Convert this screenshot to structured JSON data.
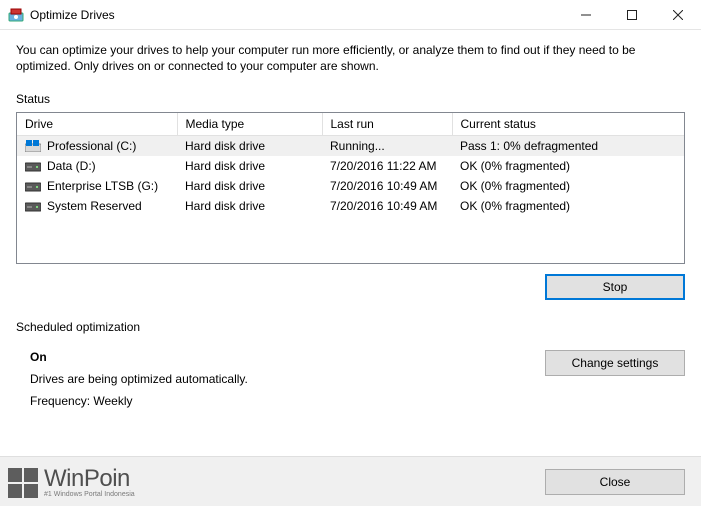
{
  "titlebar": {
    "title": "Optimize Drives"
  },
  "description": "You can optimize your drives to help your computer run more efficiently, or analyze them to find out if they need to be optimized. Only drives on or connected to your computer are shown.",
  "status_label": "Status",
  "columns": {
    "drive": "Drive",
    "media": "Media type",
    "last": "Last run",
    "status": "Current status"
  },
  "drives": [
    {
      "name": "Professional (C:)",
      "icon": "drive-windows",
      "media": "Hard disk drive",
      "last": "Running...",
      "status": "Pass 1: 0% defragmented",
      "selected": true
    },
    {
      "name": "Data (D:)",
      "icon": "drive-hdd",
      "media": "Hard disk drive",
      "last": "7/20/2016 11:22 AM",
      "status": "OK (0% fragmented)",
      "selected": false
    },
    {
      "name": "Enterprise LTSB (G:)",
      "icon": "drive-hdd",
      "media": "Hard disk drive",
      "last": "7/20/2016 10:49 AM",
      "status": "OK (0% fragmented)",
      "selected": false
    },
    {
      "name": "System Reserved",
      "icon": "drive-hdd",
      "media": "Hard disk drive",
      "last": "7/20/2016 10:49 AM",
      "status": "OK (0% fragmented)",
      "selected": false
    }
  ],
  "buttons": {
    "stop": "Stop",
    "change": "Change settings",
    "close": "Close"
  },
  "scheduled": {
    "label": "Scheduled optimization",
    "on": "On",
    "desc": "Drives are being optimized automatically.",
    "freq": "Frequency: Weekly"
  },
  "watermark": {
    "name": "WinPoin",
    "tagline": "#1 Windows Portal Indonesia"
  }
}
